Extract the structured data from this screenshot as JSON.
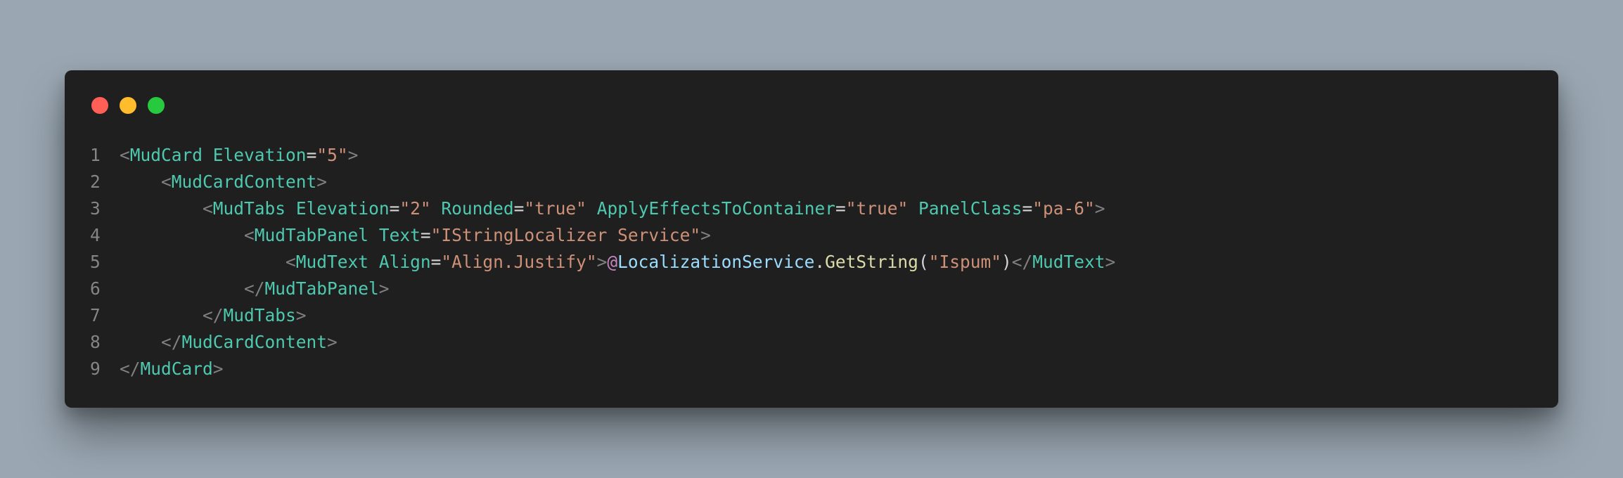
{
  "window": {
    "controls": [
      {
        "name": "close",
        "color": "#ff5f56"
      },
      {
        "name": "minimize",
        "color": "#ffbd2e"
      },
      {
        "name": "maximize",
        "color": "#27c93f"
      }
    ]
  },
  "code": {
    "lines": [
      {
        "number": "1",
        "indent": "",
        "tokens": [
          {
            "t": "<",
            "c": "punct"
          },
          {
            "t": "MudCard",
            "c": "tag"
          },
          {
            "t": " ",
            "c": "plain"
          },
          {
            "t": "Elevation",
            "c": "attr"
          },
          {
            "t": "=",
            "c": "eq"
          },
          {
            "t": "\"5\"",
            "c": "str"
          },
          {
            "t": ">",
            "c": "punct"
          }
        ]
      },
      {
        "number": "2",
        "indent": "    ",
        "tokens": [
          {
            "t": "<",
            "c": "punct"
          },
          {
            "t": "MudCardContent",
            "c": "tag"
          },
          {
            "t": ">",
            "c": "punct"
          }
        ]
      },
      {
        "number": "3",
        "indent": "        ",
        "tokens": [
          {
            "t": "<",
            "c": "punct"
          },
          {
            "t": "MudTabs",
            "c": "tag"
          },
          {
            "t": " ",
            "c": "plain"
          },
          {
            "t": "Elevation",
            "c": "attr"
          },
          {
            "t": "=",
            "c": "eq"
          },
          {
            "t": "\"2\"",
            "c": "str"
          },
          {
            "t": " ",
            "c": "plain"
          },
          {
            "t": "Rounded",
            "c": "attr"
          },
          {
            "t": "=",
            "c": "eq"
          },
          {
            "t": "\"true\"",
            "c": "str"
          },
          {
            "t": " ",
            "c": "plain"
          },
          {
            "t": "ApplyEffectsToContainer",
            "c": "attr"
          },
          {
            "t": "=",
            "c": "eq"
          },
          {
            "t": "\"true\"",
            "c": "str"
          },
          {
            "t": " ",
            "c": "plain"
          },
          {
            "t": "PanelClass",
            "c": "attr"
          },
          {
            "t": "=",
            "c": "eq"
          },
          {
            "t": "\"pa-6\"",
            "c": "str"
          },
          {
            "t": ">",
            "c": "punct"
          }
        ]
      },
      {
        "number": "4",
        "indent": "            ",
        "tokens": [
          {
            "t": "<",
            "c": "punct"
          },
          {
            "t": "MudTabPanel",
            "c": "tag"
          },
          {
            "t": " ",
            "c": "plain"
          },
          {
            "t": "Text",
            "c": "attr"
          },
          {
            "t": "=",
            "c": "eq"
          },
          {
            "t": "\"IStringLocalizer Service\"",
            "c": "str"
          },
          {
            "t": ">",
            "c": "punct"
          }
        ]
      },
      {
        "number": "5",
        "indent": "                ",
        "tokens": [
          {
            "t": "<",
            "c": "punct"
          },
          {
            "t": "MudText",
            "c": "tag"
          },
          {
            "t": " ",
            "c": "plain"
          },
          {
            "t": "Align",
            "c": "attr"
          },
          {
            "t": "=",
            "c": "eq"
          },
          {
            "t": "\"Align.Justify\"",
            "c": "str"
          },
          {
            "t": ">",
            "c": "punct"
          },
          {
            "t": "@",
            "c": "at"
          },
          {
            "t": "LocalizationService",
            "c": "var"
          },
          {
            "t": ".",
            "c": "plain"
          },
          {
            "t": "GetString",
            "c": "fn"
          },
          {
            "t": "(",
            "c": "plain"
          },
          {
            "t": "\"Ispum\"",
            "c": "str"
          },
          {
            "t": ")",
            "c": "plain"
          },
          {
            "t": "</",
            "c": "punct"
          },
          {
            "t": "MudText",
            "c": "tag"
          },
          {
            "t": ">",
            "c": "punct"
          }
        ]
      },
      {
        "number": "6",
        "indent": "            ",
        "tokens": [
          {
            "t": "</",
            "c": "punct"
          },
          {
            "t": "MudTabPanel",
            "c": "tag"
          },
          {
            "t": ">",
            "c": "punct"
          }
        ]
      },
      {
        "number": "7",
        "indent": "        ",
        "tokens": [
          {
            "t": "</",
            "c": "punct"
          },
          {
            "t": "MudTabs",
            "c": "tag"
          },
          {
            "t": ">",
            "c": "punct"
          }
        ]
      },
      {
        "number": "8",
        "indent": "    ",
        "tokens": [
          {
            "t": "</",
            "c": "punct"
          },
          {
            "t": "MudCardContent",
            "c": "tag"
          },
          {
            "t": ">",
            "c": "punct"
          }
        ]
      },
      {
        "number": "9",
        "indent": "",
        "tokens": [
          {
            "t": "</",
            "c": "punct"
          },
          {
            "t": "MudCard",
            "c": "tag"
          },
          {
            "t": ">",
            "c": "punct"
          }
        ]
      }
    ]
  }
}
